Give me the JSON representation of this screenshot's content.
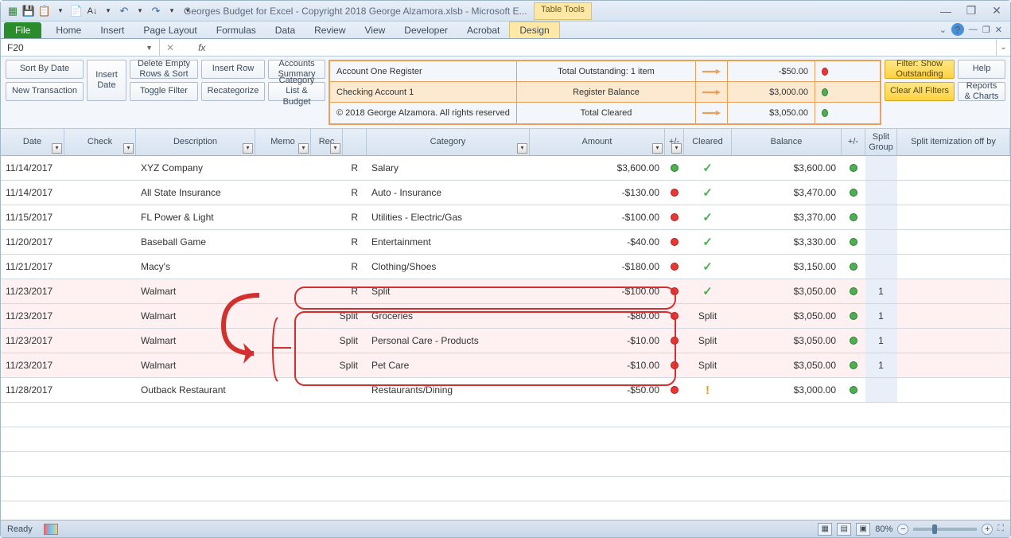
{
  "title": "Georges Budget for Excel - Copyright 2018 George Alzamora.xlsb  -  Microsoft E...",
  "table_tools": "Table Tools",
  "ribbon": {
    "file": "File",
    "tabs": [
      "Home",
      "Insert",
      "Page Layout",
      "Formulas",
      "Data",
      "Review",
      "View",
      "Developer",
      "Acrobat",
      "Design"
    ]
  },
  "namebox": "F20",
  "fx": "fx",
  "toolbar": {
    "sort_by_date": "Sort By Date",
    "new_transaction": "New Transaction",
    "insert_date": "Insert\nDate",
    "delete_empty": "Delete Empty Rows & Sort",
    "toggle_filter": "Toggle Filter",
    "insert_row": "Insert Row",
    "recategorize": "Recategorize",
    "accounts_summary": "Accounts Summary",
    "category_list": "Category List & Budget",
    "filter_show": "Filter: Show Outstanding",
    "clear_filters": "Clear All Filters",
    "help": "Help",
    "reports": "Reports & Charts"
  },
  "summary": {
    "rows": [
      {
        "label": "Account One Register",
        "desc": "Total Outstanding: 1 item",
        "amount": "-$50.00",
        "dot": "red",
        "sel": false
      },
      {
        "label": "Checking Account 1",
        "desc": "Register Balance",
        "amount": "$3,000.00",
        "dot": "green",
        "sel": true
      },
      {
        "label": "© 2018 George Alzamora. All rights reserved",
        "desc": "Total Cleared",
        "amount": "$3,050.00",
        "dot": "green",
        "sel": false
      }
    ]
  },
  "headers": {
    "date": "Date",
    "check": "Check",
    "desc": "Description",
    "memo": "Memo",
    "rec": "Rec",
    "category": "Category",
    "amount": "Amount",
    "pm": "+/-",
    "cleared": "Cleared",
    "balance": "Balance",
    "split_group": "Split Group",
    "split_item": "Split itemization off by"
  },
  "rows": [
    {
      "date": "11/14/2017",
      "desc": "XYZ Company",
      "rec": "R",
      "cat": "Salary",
      "amt": "$3,600.00",
      "dot": "green",
      "clr": "check",
      "bal": "$3,600.00",
      "pm": "green",
      "sg": "",
      "hl": false
    },
    {
      "date": "11/14/2017",
      "desc": "All State Insurance",
      "rec": "R",
      "cat": "Auto - Insurance",
      "amt": "-$130.00",
      "dot": "red",
      "clr": "check",
      "bal": "$3,470.00",
      "pm": "green",
      "sg": "",
      "hl": false
    },
    {
      "date": "11/15/2017",
      "desc": "FL Power & Light",
      "rec": "R",
      "cat": "Utilities - Electric/Gas",
      "amt": "-$100.00",
      "dot": "red",
      "clr": "check",
      "bal": "$3,370.00",
      "pm": "green",
      "sg": "",
      "hl": false
    },
    {
      "date": "11/20/2017",
      "desc": "Baseball Game",
      "rec": "R",
      "cat": "Entertainment",
      "amt": "-$40.00",
      "dot": "red",
      "clr": "check",
      "bal": "$3,330.00",
      "pm": "green",
      "sg": "",
      "hl": false
    },
    {
      "date": "11/21/2017",
      "desc": "Macy's",
      "rec": "R",
      "cat": "Clothing/Shoes",
      "amt": "-$180.00",
      "dot": "red",
      "clr": "check",
      "bal": "$3,150.00",
      "pm": "green",
      "sg": "",
      "hl": false
    },
    {
      "date": "11/23/2017",
      "desc": "Walmart",
      "rec": "R",
      "cat": "Split",
      "amt": "-$100.00",
      "dot": "red",
      "clr": "check",
      "bal": "$3,050.00",
      "pm": "green",
      "sg": "1",
      "hl": true
    },
    {
      "date": "11/23/2017",
      "desc": "Walmart",
      "rec": "Split",
      "cat": "Groceries",
      "amt": "-$80.00",
      "dot": "red",
      "clr": "Split",
      "bal": "$3,050.00",
      "pm": "green",
      "sg": "1",
      "hl": true
    },
    {
      "date": "11/23/2017",
      "desc": "Walmart",
      "rec": "Split",
      "cat": "Personal Care - Products",
      "amt": "-$10.00",
      "dot": "red",
      "clr": "Split",
      "bal": "$3,050.00",
      "pm": "green",
      "sg": "1",
      "hl": true
    },
    {
      "date": "11/23/2017",
      "desc": "Walmart",
      "rec": "Split",
      "cat": "Pet Care",
      "amt": "-$10.00",
      "dot": "red",
      "clr": "Split",
      "bal": "$3,050.00",
      "pm": "green",
      "sg": "1",
      "hl": true
    },
    {
      "date": "11/28/2017",
      "desc": "Outback Restaurant",
      "rec": "",
      "cat": "Restaurants/Dining",
      "amt": "-$50.00",
      "dot": "red",
      "clr": "exclaim",
      "bal": "$3,000.00",
      "pm": "green",
      "sg": "",
      "hl": false
    }
  ],
  "status": {
    "ready": "Ready",
    "zoom": "80%"
  }
}
